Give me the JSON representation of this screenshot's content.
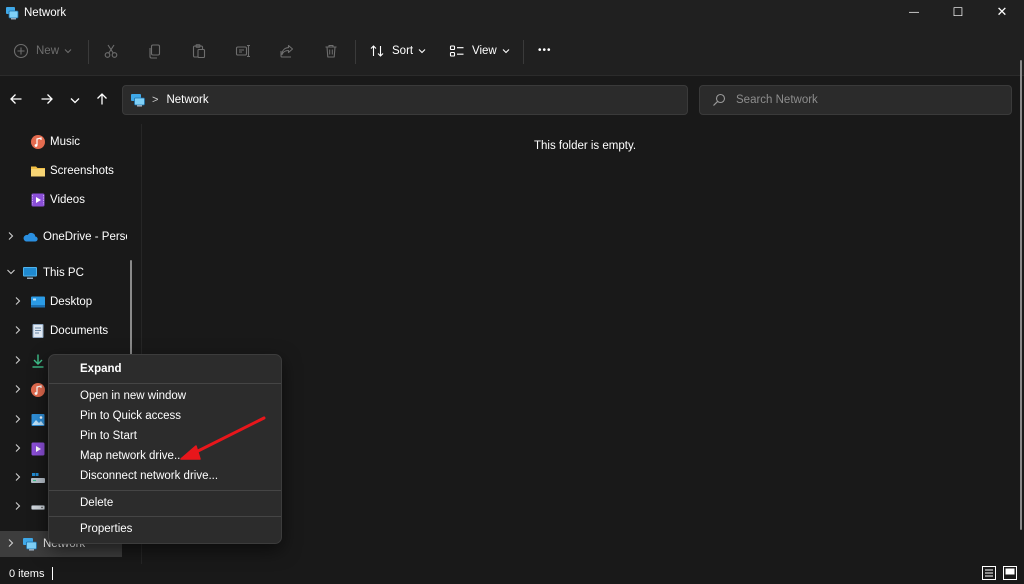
{
  "window": {
    "title": "Network",
    "minimize_glyph": "—",
    "maximize_glyph": "☐",
    "close_glyph": "✕"
  },
  "commandbar": {
    "new_label": "New",
    "sort_label": "Sort",
    "view_label": "View",
    "more_glyph": "•••"
  },
  "address": {
    "crumb_sep": ">",
    "location": "Network",
    "search_placeholder": "Search Network"
  },
  "navpane": {
    "items": [
      {
        "label": "Music",
        "icon": "music-icon"
      },
      {
        "label": "Screenshots",
        "icon": "folder-icon"
      },
      {
        "label": "Videos",
        "icon": "videos-icon"
      },
      {
        "label": "OneDrive - Perso",
        "icon": "onedrive-icon"
      },
      {
        "label": "This PC",
        "icon": "pc-icon"
      },
      {
        "label": "Desktop",
        "icon": "desktop-icon"
      },
      {
        "label": "Documents",
        "icon": "documents-icon"
      },
      {
        "label": "Network",
        "icon": "network-icon"
      }
    ]
  },
  "content": {
    "empty_message": "This folder is empty."
  },
  "context_menu": {
    "items": [
      "Expand",
      "Open in new window",
      "Pin to Quick access",
      "Pin to Start",
      "Map network drive...",
      "Disconnect network drive...",
      "Delete",
      "Properties"
    ]
  },
  "status": {
    "item_count": "0 items"
  },
  "colors": {
    "background": "#191919",
    "chrome": "#202020",
    "menu": "#2c2c2c",
    "annotation_arrow": "#e8161b",
    "folder_yellow": "#f2c045",
    "onedrive_blue": "#2a8fe0"
  }
}
